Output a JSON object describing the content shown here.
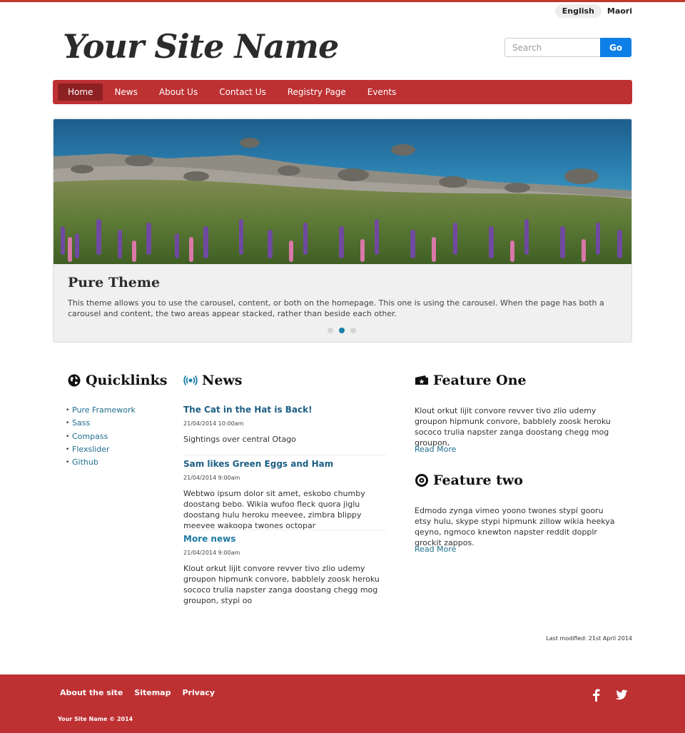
{
  "colors": {
    "brand": "#bd3133",
    "brand_dark": "#8d2022",
    "link": "#1e6e8e",
    "search_button": "#0e7fe6"
  },
  "language": {
    "options": [
      "English",
      "Maori"
    ],
    "selected": "English"
  },
  "header": {
    "site_name": "Your Site Name",
    "search_placeholder": "Search",
    "search_button": "Go"
  },
  "nav": {
    "items": [
      "Home",
      "News",
      "About Us",
      "Contact Us",
      "Registry Page",
      "Events"
    ],
    "active": "Home"
  },
  "carousel": {
    "image": "lakeshore-lupins-photo",
    "title": "Pure Theme",
    "text": "This theme allows you to use the carousel, content, or both on the homepage. This one is using the carousel. When the page has both a carousel and content, the two areas appear stacked, rather than beside each other.",
    "slide_count": 3,
    "active_slide": 2
  },
  "quicklinks": {
    "title": "Quicklinks",
    "icon": "globe-icon",
    "items": [
      "Pure Framework",
      "Sass",
      "Compass",
      "Flexslider",
      "Github"
    ]
  },
  "news": {
    "title": "News",
    "icon": "broadcast-icon",
    "items": [
      {
        "title": "The Cat in the Hat is Back!",
        "date": "21/04/2014 10:00am",
        "body": "Sightings over central Otago"
      },
      {
        "title": "Sam likes Green Eggs and Ham",
        "date": "21/04/2014 9:00am",
        "body": "Webtwo ipsum dolor sit amet, eskobo chumby doostang bebo. Wikia wufoo fleck quora jiglu doostang hulu heroku meevee, zimbra blippy meevee wakoopa twones octopar"
      },
      {
        "title": "More news",
        "date": "21/04/2014 9:00am",
        "body": "Klout orkut lijit convore revver tivo zlio udemy groupon hipmunk convore, babblely zoosk heroku sococo trulia napster zanga doostang chegg mog groupon, stypi oo"
      }
    ]
  },
  "features": [
    {
      "title": "Feature One",
      "icon": "ticket-icon",
      "text": "Klout orkut lijit convore revver tivo zlio udemy groupon hipmunk convore, babblely zoosk heroku sococo trulia napster zanga doostang chegg mog groupon,",
      "link": "Read More"
    },
    {
      "title": "Feature two",
      "icon": "target-icon",
      "text": "Edmodo zynga vimeo yoono twones stypi gooru etsy hulu, skype stypi hipmunk zillow wikia heekya qeyno, ngmoco knewton napster reddit dopplr grockit zappos.",
      "link": "Read More"
    }
  ],
  "last_modified": "Last modified: 21st April 2014",
  "footer": {
    "links": [
      "About the site",
      "Sitemap",
      "Privacy"
    ],
    "copyright": "Your Site Name © 2014",
    "social": [
      "facebook-icon",
      "twitter-icon"
    ]
  }
}
